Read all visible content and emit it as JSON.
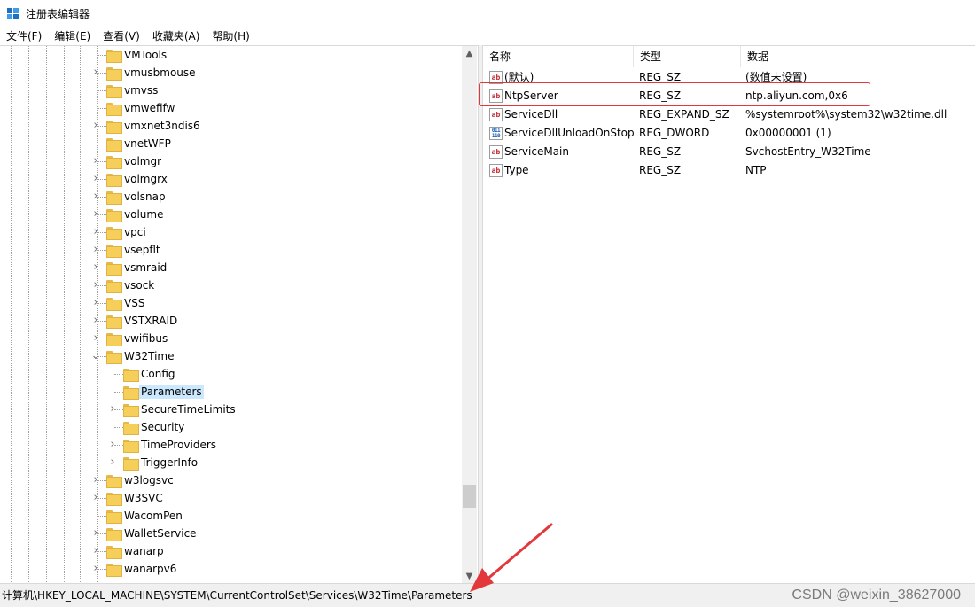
{
  "window": {
    "title": "注册表编辑器"
  },
  "menu": [
    "文件(F)",
    "编辑(E)",
    "查看(V)",
    "收藏夹(A)",
    "帮助(H)"
  ],
  "tree": {
    "items": [
      {
        "label": "VMTools",
        "level": 1,
        "expandable": false,
        "expanded": false,
        "selected": false
      },
      {
        "label": "vmusbmouse",
        "level": 1,
        "expandable": true,
        "expanded": false,
        "selected": false
      },
      {
        "label": "vmvss",
        "level": 1,
        "expandable": false,
        "expanded": false,
        "selected": false
      },
      {
        "label": "vmwefifw",
        "level": 1,
        "expandable": false,
        "expanded": false,
        "selected": false
      },
      {
        "label": "vmxnet3ndis6",
        "level": 1,
        "expandable": true,
        "expanded": false,
        "selected": false
      },
      {
        "label": "vnetWFP",
        "level": 1,
        "expandable": false,
        "expanded": false,
        "selected": false
      },
      {
        "label": "volmgr",
        "level": 1,
        "expandable": true,
        "expanded": false,
        "selected": false
      },
      {
        "label": "volmgrx",
        "level": 1,
        "expandable": true,
        "expanded": false,
        "selected": false
      },
      {
        "label": "volsnap",
        "level": 1,
        "expandable": true,
        "expanded": false,
        "selected": false
      },
      {
        "label": "volume",
        "level": 1,
        "expandable": true,
        "expanded": false,
        "selected": false
      },
      {
        "label": "vpci",
        "level": 1,
        "expandable": true,
        "expanded": false,
        "selected": false
      },
      {
        "label": "vsepflt",
        "level": 1,
        "expandable": true,
        "expanded": false,
        "selected": false
      },
      {
        "label": "vsmraid",
        "level": 1,
        "expandable": true,
        "expanded": false,
        "selected": false
      },
      {
        "label": "vsock",
        "level": 1,
        "expandable": true,
        "expanded": false,
        "selected": false
      },
      {
        "label": "VSS",
        "level": 1,
        "expandable": true,
        "expanded": false,
        "selected": false
      },
      {
        "label": "VSTXRAID",
        "level": 1,
        "expandable": true,
        "expanded": false,
        "selected": false
      },
      {
        "label": "vwifibus",
        "level": 1,
        "expandable": true,
        "expanded": false,
        "selected": false
      },
      {
        "label": "W32Time",
        "level": 1,
        "expandable": true,
        "expanded": true,
        "selected": false
      },
      {
        "label": "Config",
        "level": 2,
        "expandable": false,
        "expanded": false,
        "selected": false
      },
      {
        "label": "Parameters",
        "level": 2,
        "expandable": false,
        "expanded": false,
        "selected": true
      },
      {
        "label": "SecureTimeLimits",
        "level": 2,
        "expandable": true,
        "expanded": false,
        "selected": false
      },
      {
        "label": "Security",
        "level": 2,
        "expandable": false,
        "expanded": false,
        "selected": false
      },
      {
        "label": "TimeProviders",
        "level": 2,
        "expandable": true,
        "expanded": false,
        "selected": false
      },
      {
        "label": "TriggerInfo",
        "level": 2,
        "expandable": true,
        "expanded": false,
        "selected": false
      },
      {
        "label": "w3logsvc",
        "level": 1,
        "expandable": true,
        "expanded": false,
        "selected": false
      },
      {
        "label": "W3SVC",
        "level": 1,
        "expandable": true,
        "expanded": false,
        "selected": false
      },
      {
        "label": "WacomPen",
        "level": 1,
        "expandable": false,
        "expanded": false,
        "selected": false
      },
      {
        "label": "WalletService",
        "level": 1,
        "expandable": true,
        "expanded": false,
        "selected": false
      },
      {
        "label": "wanarp",
        "level": 1,
        "expandable": true,
        "expanded": false,
        "selected": false
      },
      {
        "label": "wanarpv6",
        "level": 1,
        "expandable": true,
        "expanded": false,
        "selected": false
      }
    ]
  },
  "list": {
    "columns": {
      "name": "名称",
      "type": "类型",
      "data": "数据"
    },
    "rows": [
      {
        "icon": "string-value-icon",
        "name": "(默认)",
        "type": "REG_SZ",
        "data": "(数值未设置)"
      },
      {
        "icon": "string-value-icon",
        "name": "NtpServer",
        "type": "REG_SZ",
        "data": "ntp.aliyun.com,0x6"
      },
      {
        "icon": "string-value-icon",
        "name": "ServiceDll",
        "type": "REG_EXPAND_SZ",
        "data": "%systemroot%\\system32\\w32time.dll"
      },
      {
        "icon": "dword-value-icon",
        "name": "ServiceDllUnloadOnStop",
        "type": "REG_DWORD",
        "data": "0x00000001 (1)"
      },
      {
        "icon": "string-value-icon",
        "name": "ServiceMain",
        "type": "REG_SZ",
        "data": "SvchostEntry_W32Time"
      },
      {
        "icon": "string-value-icon",
        "name": "Type",
        "type": "REG_SZ",
        "data": "NTP"
      }
    ]
  },
  "status": {
    "path": "计算机\\HKEY_LOCAL_MACHINE\\SYSTEM\\CurrentControlSet\\Services\\W32Time\\Parameters",
    "watermark": "CSDN @weixin_38627000"
  },
  "icons": {
    "string_glyph": "ab",
    "dword_glyph": "011\n110",
    "chevron_collapsed": "›",
    "chevron_expanded": "⌄",
    "scroll_up": "▲",
    "scroll_down": "▼"
  },
  "colors": {
    "selection": "#cce8ff",
    "annotation_red": "#e2383c",
    "folder": "#f6cf5b",
    "string_icon": "#c2262e"
  }
}
